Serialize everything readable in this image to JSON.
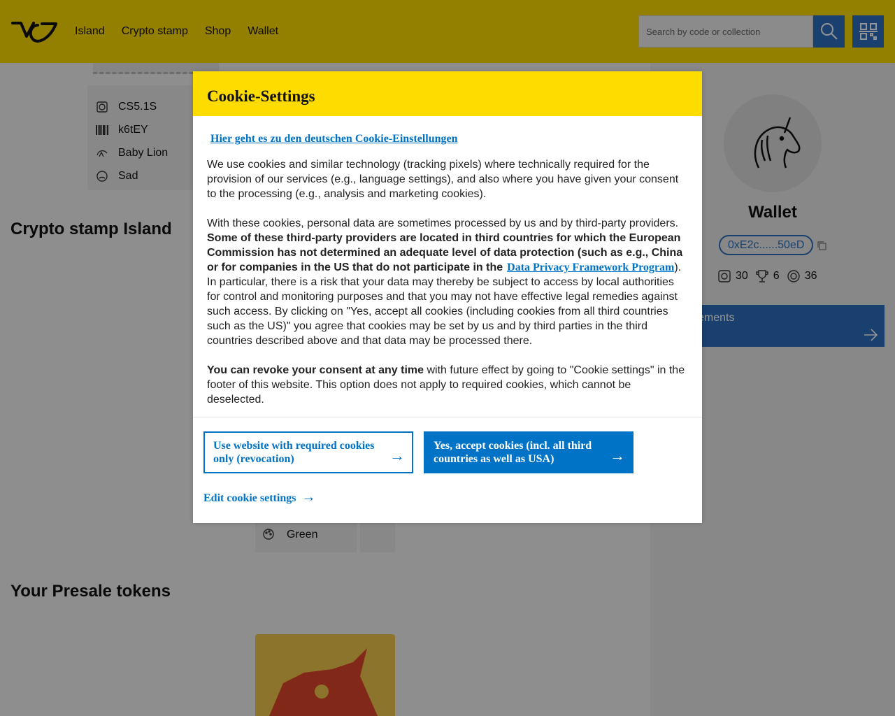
{
  "header": {
    "nav": [
      "Island",
      "Crypto stamp",
      "Shop",
      "Wallet"
    ],
    "search_placeholder": "Search by code or collection"
  },
  "stamp_attributes": [
    {
      "icon": "stamp-icon",
      "label": "CS5.1S"
    },
    {
      "icon": "barcode-icon",
      "label": "k6tEY"
    },
    {
      "icon": "lion-icon",
      "label": "Baby Lion"
    },
    {
      "icon": "mood-icon",
      "label": "Sad"
    }
  ],
  "sections": {
    "island_title": "Crypto stamp Island",
    "presale_title": "Your Presale tokens",
    "green_label": "Green"
  },
  "wallet": {
    "title": "Wallet",
    "address": "0xE2c......50eD",
    "stats": [
      {
        "icon": "stamp-count-icon",
        "value": "30"
      },
      {
        "icon": "trophy-icon",
        "value": "6"
      },
      {
        "icon": "token-icon",
        "value": "36"
      }
    ],
    "achievements_label": "ements"
  },
  "cookie_modal": {
    "title": "Cookie-Settings",
    "german_link": "Hier geht es zu den deutschen Cookie-Einstellungen",
    "para1": "We use cookies and similar technology (tracking pixels) where technically required for the provision of our services (e.g., language settings), and also where you have given your consent to the processing (e.g., analysis and marketing cookies).",
    "para2_start": "With these cookies, personal data are sometimes processed by us and by third-party providers.",
    "para2_bold": "Some of these third-party providers are located in third countries for which the European Commission has not determined an adequate level of data protection (such as e.g., China or for companies in the US that do not participate in the",
    "para2_link": "Data Privacy Framework Program",
    "para2_end": "In particular, there is a risk that your data may thereby be subject to access by local authorities for control and monitoring purposes and that you may not have effective legal remedies against such access. By clicking on \"Yes, accept all cookies (including cookies from all third countries such as the US)\" you agree that cookies may be set by us and by third parties in the third countries described above and that data may be processed there.",
    "para3_bold": "You can revoke your consent at any time",
    "para3_end": " with future effect by going to \"Cookie settings\" in the footer of this website. This option does not apply to required cookies, which cannot be deselected.",
    "btn_required": "Use website with required cookies only (revocation)",
    "btn_accept": "Yes, accept cookies (incl. all third countries as well as USA)",
    "edit_link": "Edit cookie settings",
    "arrow": "→"
  },
  "colors": {
    "brand_yellow": "#ffdc00",
    "brand_blue": "#0073c6",
    "wallet_blue": "#2c6fbd"
  }
}
